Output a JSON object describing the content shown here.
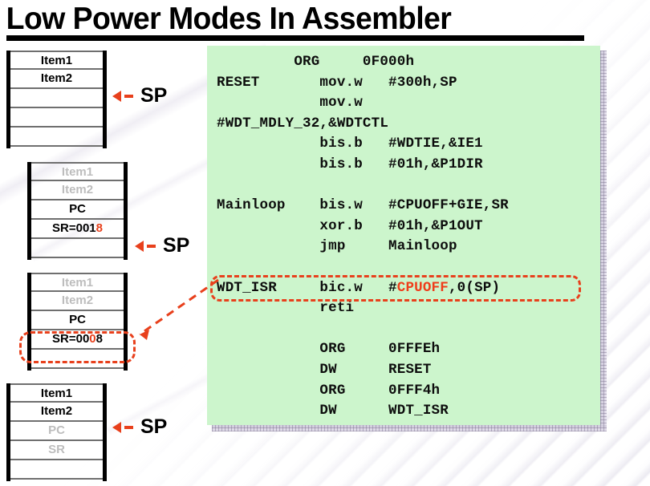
{
  "slide": {
    "title": "Low Power Modes In Assembler",
    "accent_red": "#e8401c",
    "code_bg": "#ccf5cc",
    "faded_text": "#bdbdbd"
  },
  "stacks": [
    {
      "id": "stack-1",
      "cells": [
        {
          "text": "Item1",
          "style": "normal"
        },
        {
          "text": "Item2",
          "style": "normal"
        },
        {
          "text": "",
          "style": "empty"
        },
        {
          "text": "",
          "style": "empty"
        },
        {
          "text": "",
          "style": "empty"
        }
      ],
      "sp_label": "SP",
      "sp_row": 1
    },
    {
      "id": "stack-2",
      "cells": [
        {
          "text": "Item1",
          "style": "faded"
        },
        {
          "text": "Item2",
          "style": "faded"
        },
        {
          "text": "PC",
          "style": "normal"
        },
        {
          "text": "SR=0018",
          "style": "normal",
          "hot_index": 6
        },
        {
          "text": "",
          "style": "empty"
        }
      ],
      "sp_label": "SP",
      "sp_row": 3
    },
    {
      "id": "stack-3",
      "cells": [
        {
          "text": "Item1",
          "style": "faded"
        },
        {
          "text": "Item2",
          "style": "faded"
        },
        {
          "text": "PC",
          "style": "normal"
        },
        {
          "text": "SR=0008",
          "style": "normal",
          "hot_index": 5
        },
        {
          "text": "",
          "style": "empty"
        }
      ],
      "sp_label": "",
      "sp_row": -1,
      "highlight_row": 3
    },
    {
      "id": "stack-4",
      "cells": [
        {
          "text": "Item1",
          "style": "normal"
        },
        {
          "text": "Item2",
          "style": "normal"
        },
        {
          "text": "PC",
          "style": "faded"
        },
        {
          "text": "SR",
          "style": "faded"
        },
        {
          "text": "",
          "style": "empty"
        }
      ],
      "sp_label": "SP",
      "sp_row": 1
    }
  ],
  "code": {
    "lines": [
      "         ORG     0F000h",
      "RESET       mov.w   #300h,SP",
      "            mov.w",
      "#WDT_MDLY_32,&WDTCTL",
      "            bis.b   #WDTIE,&IE1",
      "            bis.b   #01h,&P1DIR",
      "",
      "Mainloop    bis.w   #CPUOFF+GIE,SR",
      "            xor.b   #01h,&P1OUT",
      "            jmp     Mainloop",
      "",
      "WDT_ISR     bic.w   #CPUOFF,0(SP)",
      "            reti",
      "",
      "            ORG     0FFFEh",
      "            DW      RESET",
      "            ORG     0FFF4h",
      "            DW      WDT_ISR"
    ],
    "highlight_line_index": 11,
    "highlight_token": "CPUOFF"
  }
}
